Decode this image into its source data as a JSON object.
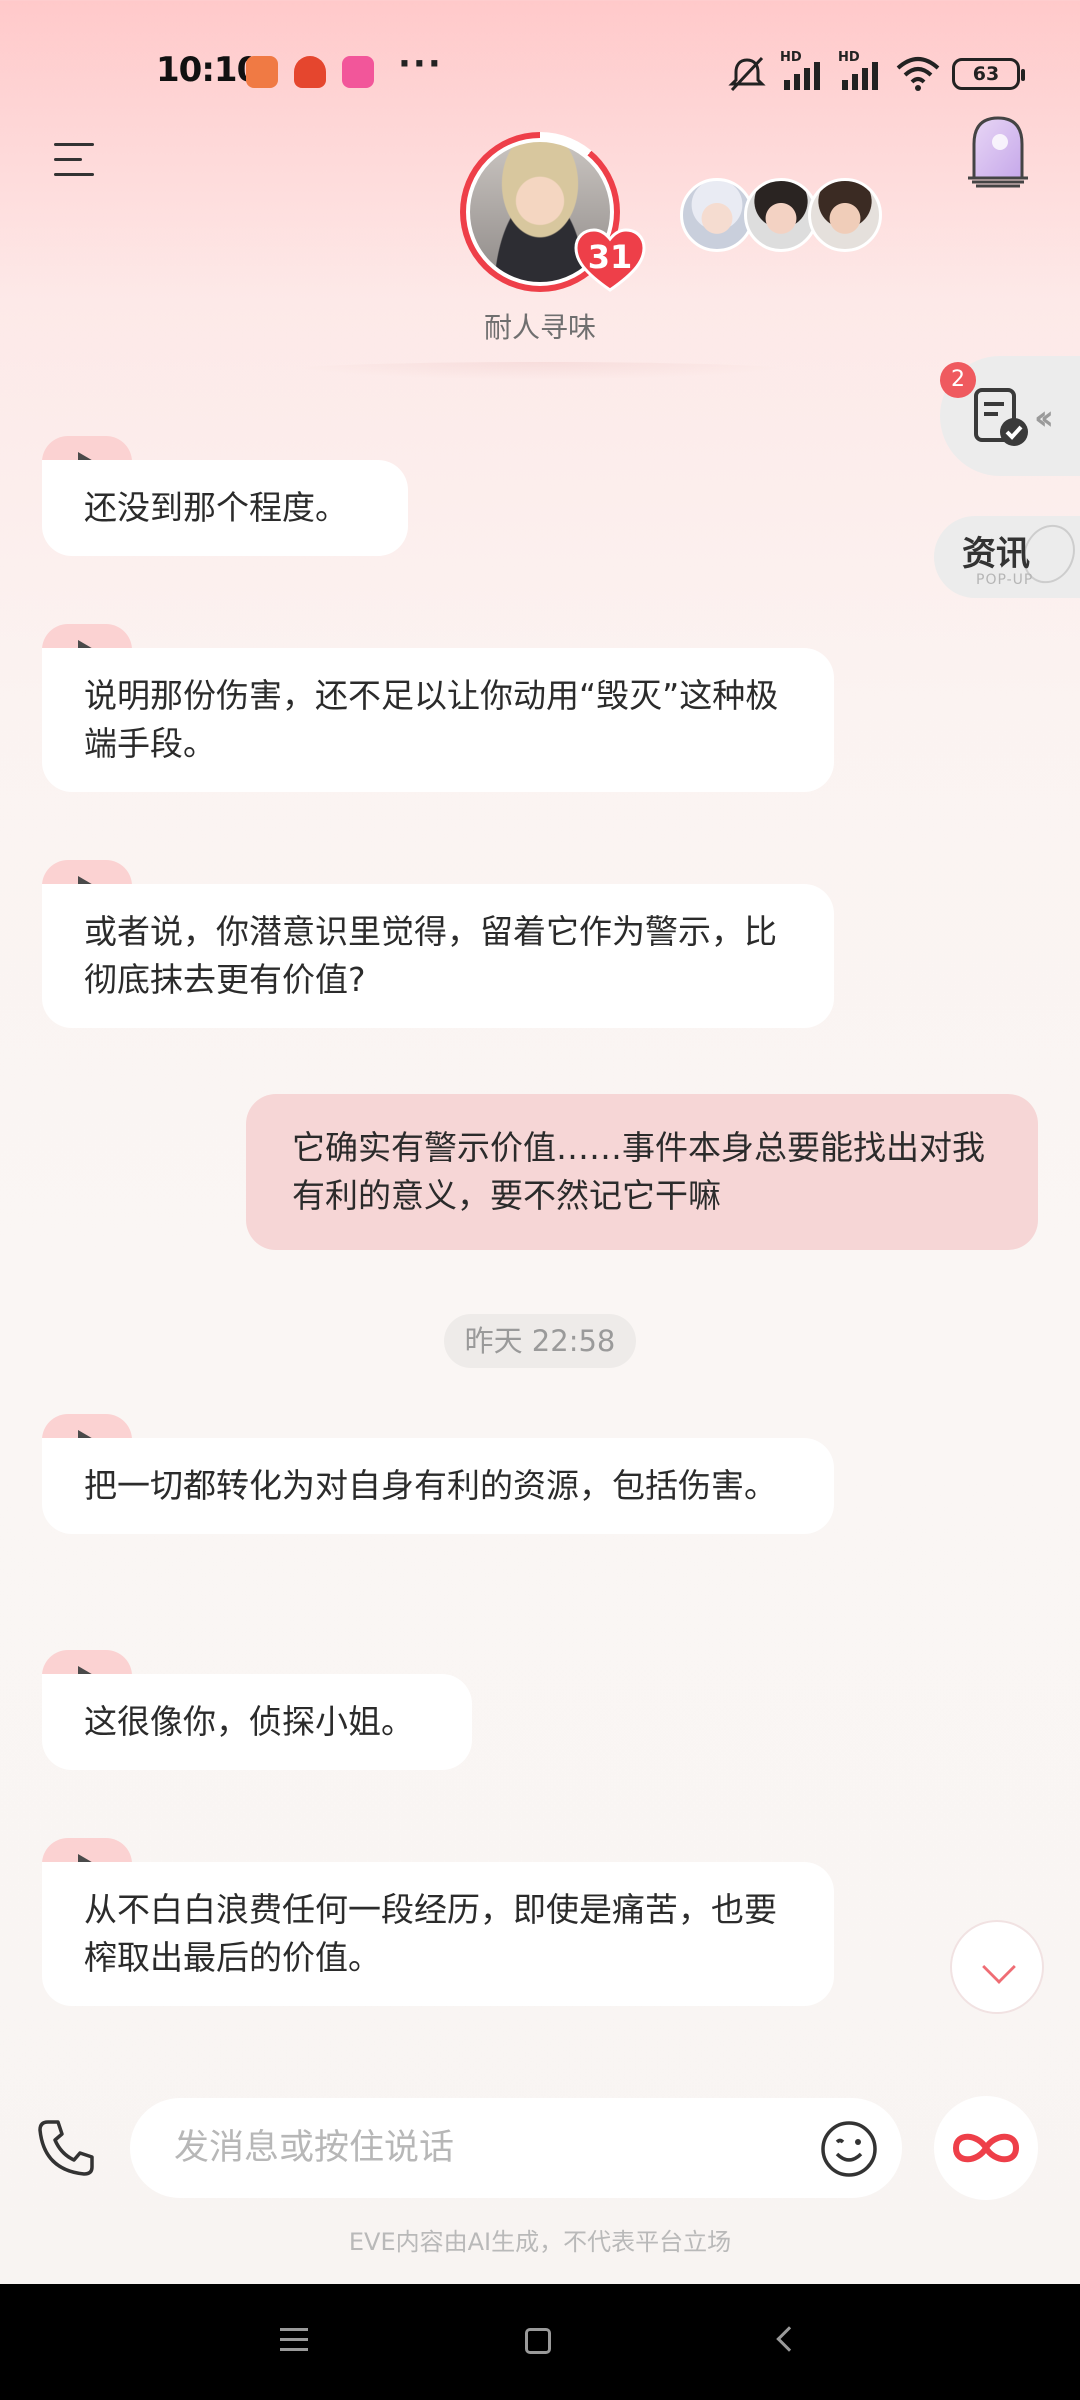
{
  "status_bar": {
    "time": "10:10",
    "more_dots": "···",
    "network_1": "HD",
    "network_2": "HD",
    "battery": "63"
  },
  "header": {
    "character_name": "耐人寻味",
    "affection_level": "31"
  },
  "side": {
    "task_badge_count": "2",
    "news_label": "资讯",
    "news_sublabel": "POP-UP"
  },
  "messages": [
    {
      "role": "ai",
      "text": "还没到那个程度。"
    },
    {
      "role": "ai",
      "text": "说明那份伤害，还不足以让你动用“毁灭”这种极端手段。"
    },
    {
      "role": "ai",
      "text": "或者说，你潜意识里觉得，留着它作为警示，比彻底抹去更有价值?"
    },
    {
      "role": "user",
      "text": "它确实有警示价值……事件本身总要能找出对我有利的意义，要不然记它干嘛"
    },
    {
      "role": "ai",
      "text": "把一切都转化为对自身有利的资源，包括伤害。"
    },
    {
      "role": "ai",
      "text": "这很像你，侦探小姐。"
    },
    {
      "role": "ai",
      "text": "从不白白浪费任何一段经历，即使是痛苦，也要榨取出最后的价值。"
    }
  ],
  "timestamp": "昨天 22:58",
  "input": {
    "placeholder": "发消息或按住说话"
  },
  "disclaimer": "EVE内容由AI生成，不代表平台立场",
  "colors": {
    "accent": "#ee3f49",
    "user_bubble": "#f6d6d6",
    "play_tab": "#fbd2d2"
  }
}
